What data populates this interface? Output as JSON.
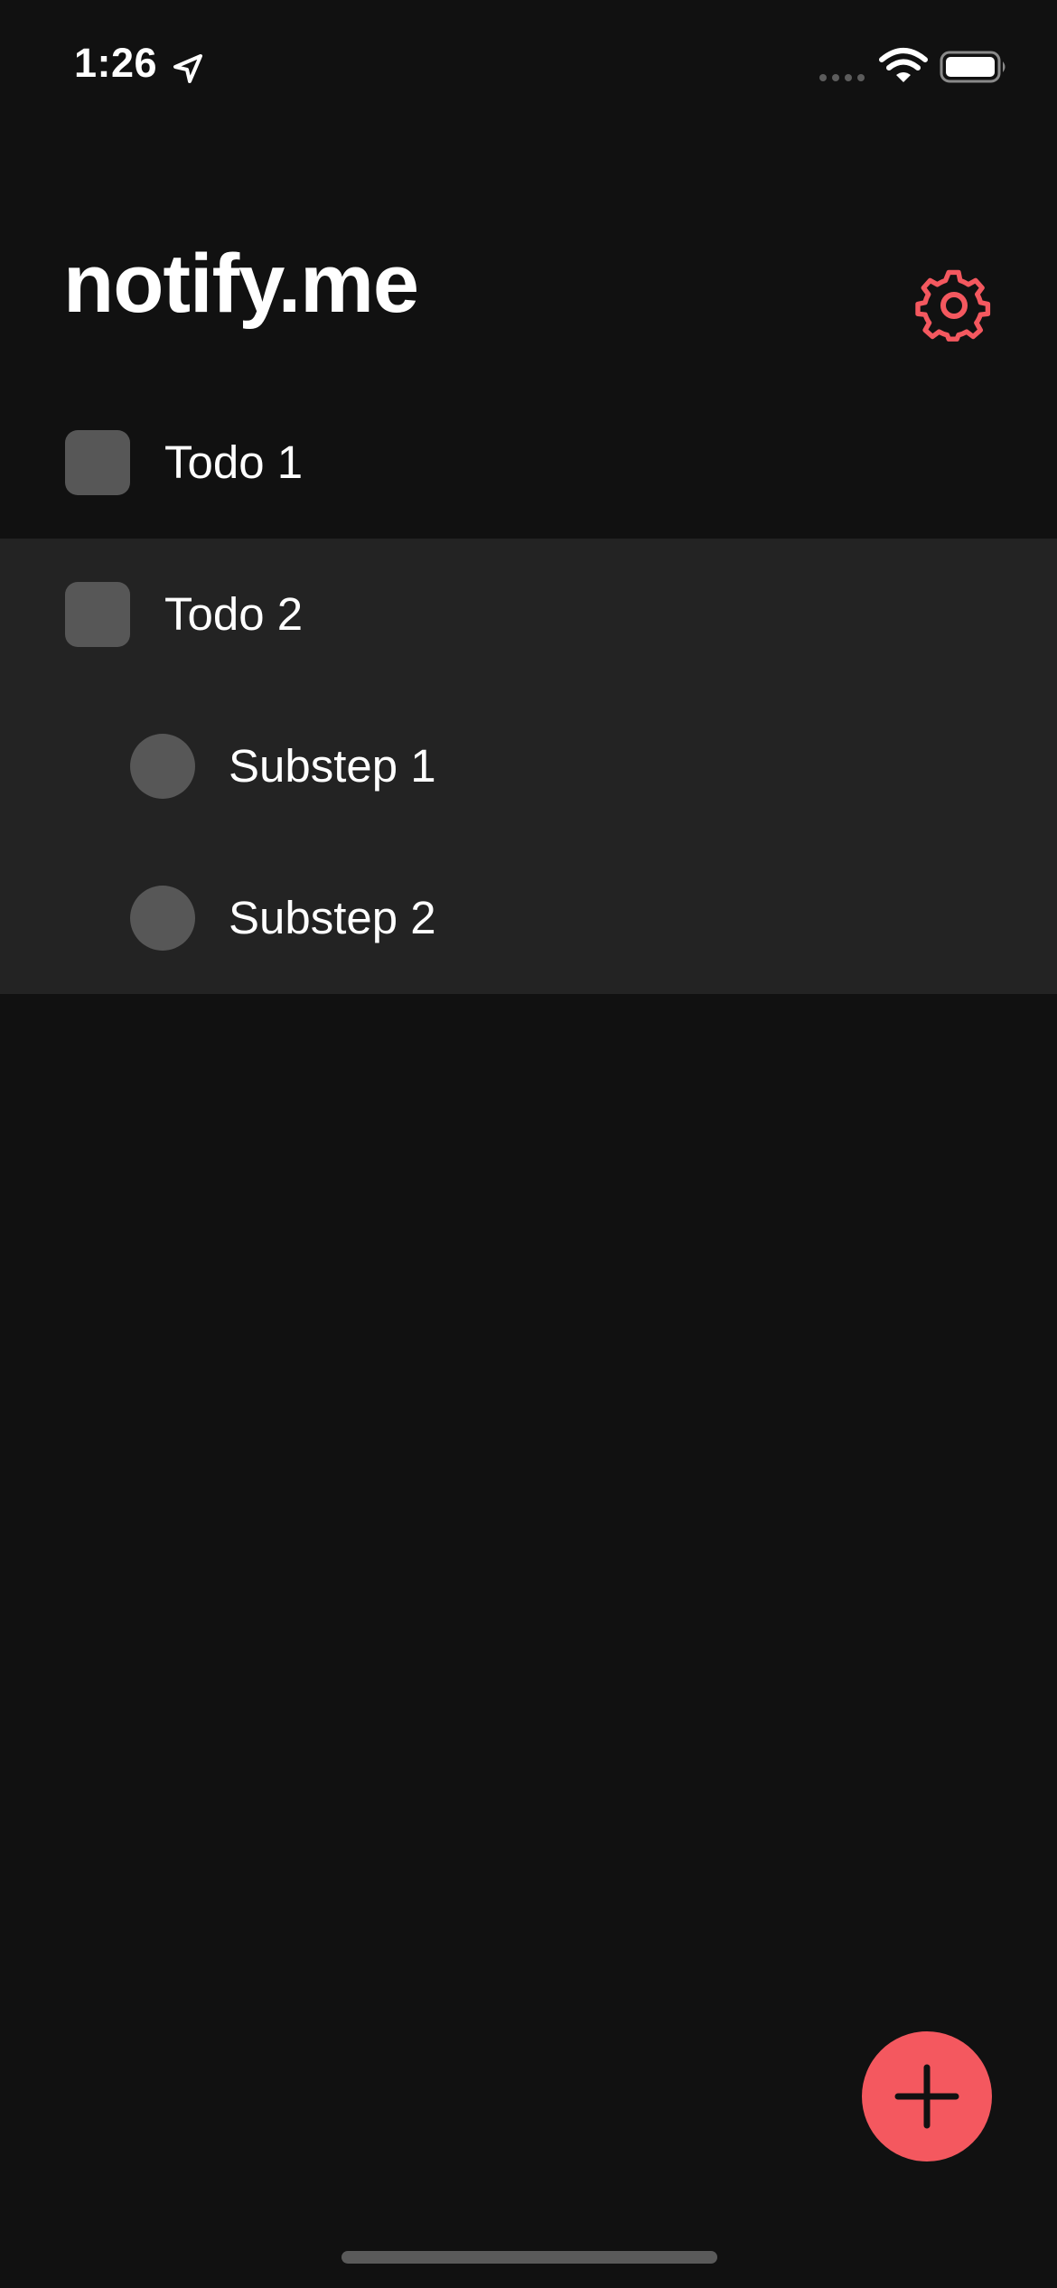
{
  "status_bar": {
    "time": "1:26",
    "icons": [
      "location-arrow-icon",
      "cellular-signal-icon",
      "wifi-icon",
      "battery-icon"
    ]
  },
  "header": {
    "title": "notify.me",
    "settings_icon": "gear-icon"
  },
  "todos": [
    {
      "label": "Todo 1",
      "checked": false,
      "expanded": false,
      "substeps": []
    },
    {
      "label": "Todo 2",
      "checked": false,
      "expanded": true,
      "substeps": [
        {
          "label": "Substep 1",
          "checked": false
        },
        {
          "label": "Substep 2",
          "checked": false
        }
      ]
    }
  ],
  "fab": {
    "icon": "plus-icon"
  },
  "colors": {
    "background": "#111111",
    "selected_group_background": "#232323",
    "checkbox": "#575757",
    "accent": "#f4585f",
    "text": "#ffffff"
  }
}
